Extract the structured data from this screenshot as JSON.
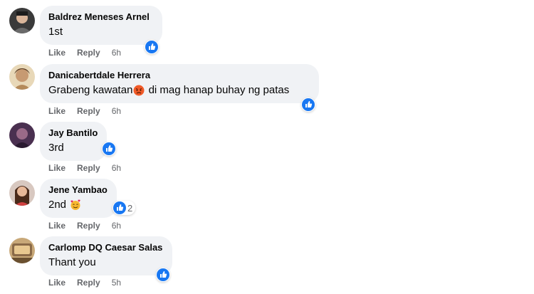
{
  "comments": [
    {
      "author": "Baldrez Meneses Arnel",
      "text": "1st",
      "like": "Like",
      "reply": "Reply",
      "time": "6h",
      "reaction_count": ""
    },
    {
      "author": "Danicabertdale Herrera",
      "text_before": "Grabeng kawatan",
      "emoji": "angry-face",
      "text_after": " di mag hanap buhay ng patas",
      "like": "Like",
      "reply": "Reply",
      "time": "6h",
      "reaction_count": ""
    },
    {
      "author": "Jay Bantilo",
      "text": "3rd",
      "like": "Like",
      "reply": "Reply",
      "time": "6h",
      "reaction_count": ""
    },
    {
      "author": "Jene Yambao",
      "text": "2nd",
      "emoji": "smiling-face-with-hearts",
      "like": "Like",
      "reply": "Reply",
      "time": "6h",
      "reaction_count": "2"
    },
    {
      "author": "Carlomp DQ Caesar Salas",
      "text": "Thant you",
      "like": "Like",
      "reply": "Reply",
      "time": "5h",
      "reaction_count": ""
    }
  ],
  "colors": {
    "bubble": "#f0f2f5",
    "like_blue": "#1877f2",
    "meta": "#65676b"
  },
  "icons": {
    "reaction": "thumbs-up-icon"
  }
}
